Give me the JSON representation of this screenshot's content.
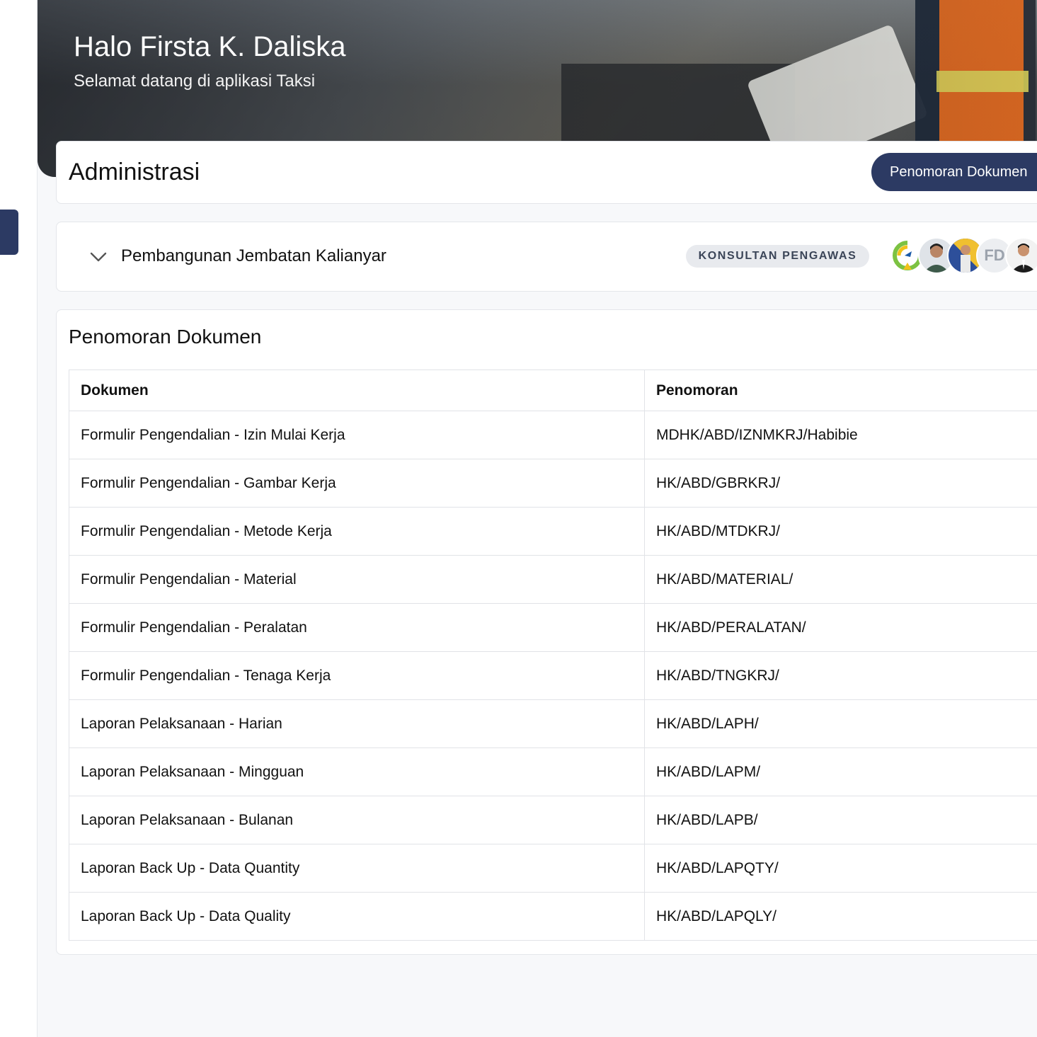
{
  "header": {
    "greeting": "Halo Firsta K. Daliska",
    "welcome": "Selamat datang di aplikasi Taksi"
  },
  "admin": {
    "title": "Administrasi",
    "button_label": "Penomoran Dokumen"
  },
  "project": {
    "name": "Pembangunan Jembatan Kalianyar",
    "role": "KONSULTAN PENGAWAS",
    "avatars": [
      "logo",
      "photo",
      "photo",
      "FD",
      "photo"
    ],
    "avatar_initials": "FD"
  },
  "table": {
    "title": "Penomoran Dokumen",
    "headers": [
      "Dokumen",
      "Penomoran"
    ],
    "rows": [
      [
        "Formulir Pengendalian - Izin Mulai Kerja",
        "MDHK/ABD/IZNMKRJ/Habibie"
      ],
      [
        "Formulir Pengendalian - Gambar Kerja",
        "HK/ABD/GBRKRJ/"
      ],
      [
        "Formulir Pengendalian - Metode Kerja",
        "HK/ABD/MTDKRJ/"
      ],
      [
        "Formulir Pengendalian - Material",
        "HK/ABD/MATERIAL/"
      ],
      [
        "Formulir Pengendalian - Peralatan",
        "HK/ABD/PERALATAN/"
      ],
      [
        "Formulir Pengendalian - Tenaga Kerja",
        "HK/ABD/TNGKRJ/"
      ],
      [
        "Laporan Pelaksanaan - Harian",
        "HK/ABD/LAPH/"
      ],
      [
        "Laporan Pelaksanaan - Mingguan",
        "HK/ABD/LAPM/"
      ],
      [
        "Laporan Pelaksanaan - Bulanan",
        "HK/ABD/LAPB/"
      ],
      [
        "Laporan Back Up - Data Quantity",
        "HK/ABD/LAPQTY/"
      ],
      [
        "Laporan Back Up - Data Quality",
        "HK/ABD/LAPQLY/"
      ]
    ]
  },
  "colors": {
    "primary": "#2c3a63",
    "badge_bg": "#e8eaee",
    "page_bg": "#f7f8fa"
  }
}
